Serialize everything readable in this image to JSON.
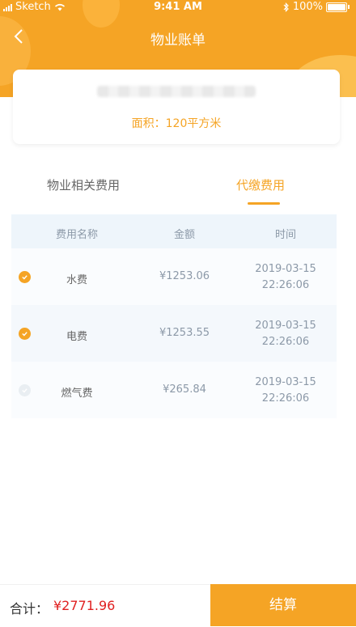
{
  "status_bar": {
    "carrier": "Sketch",
    "time": "9:41 AM",
    "battery": "100%"
  },
  "header": {
    "title": "物业账单"
  },
  "property_card": {
    "area": "面积：120平方米"
  },
  "tabs": [
    {
      "label": "物业相关费用",
      "active": false
    },
    {
      "label": "代缴费用",
      "active": true
    }
  ],
  "table": {
    "headers": [
      "费用名称",
      "金额",
      "时间"
    ],
    "rows": [
      {
        "name": "水费",
        "amount": "¥1253.06",
        "date": "2019-03-15",
        "time": "22:26:06",
        "checked": true
      },
      {
        "name": "电费",
        "amount": "¥1253.55",
        "date": "2019-03-15",
        "time": "22:26:06",
        "checked": true
      },
      {
        "name": "燃气费",
        "amount": "¥265.84",
        "date": "2019-03-15",
        "time": "22:26:06",
        "checked": false
      }
    ]
  },
  "footer": {
    "total_label": "合计：",
    "total_value": "¥2771.96",
    "settle_label": "结算"
  },
  "colors": {
    "accent": "#f5a425",
    "price": "#e02020"
  }
}
